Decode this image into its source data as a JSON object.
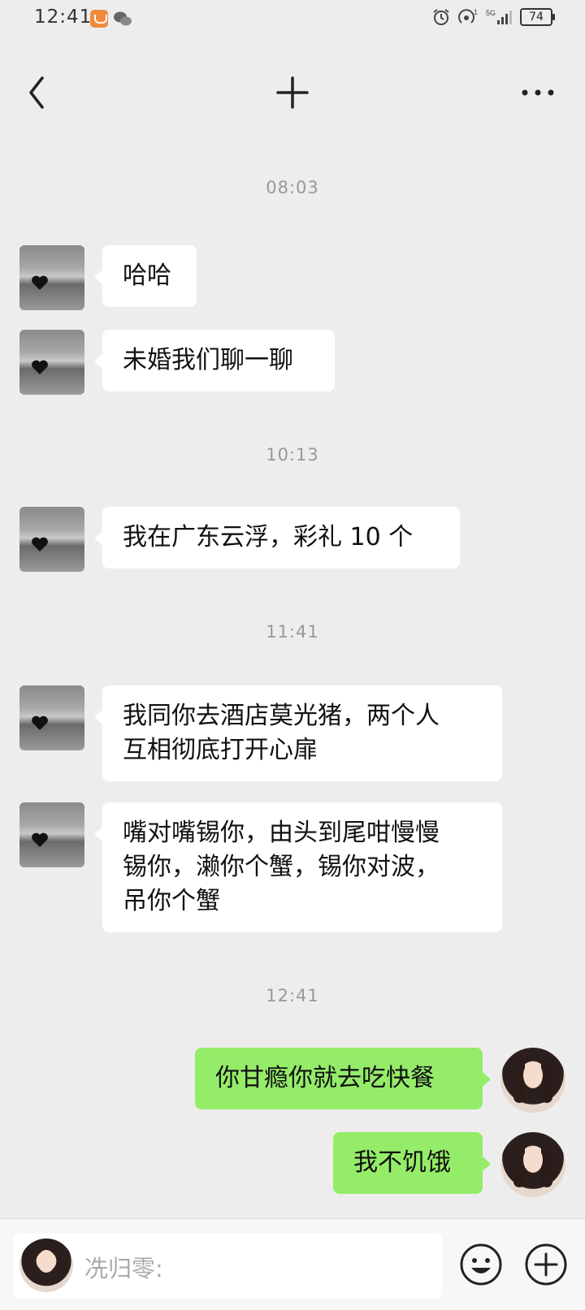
{
  "status_bar": {
    "time": "12:41",
    "battery": "74",
    "network": "5G"
  },
  "nav": {
    "back_icon": "chevron-left-icon",
    "plus_icon": "plus-icon",
    "more_icon": "more-horizontal-icon"
  },
  "timestamps": [
    "08:03",
    "10:13",
    "11:41",
    "12:41"
  ],
  "messages": [
    {
      "side": "left",
      "lines": [
        "哈哈"
      ]
    },
    {
      "side": "left",
      "lines": [
        "未婚我们聊一聊"
      ]
    },
    {
      "side": "left",
      "lines": [
        "我在广东云浮，彩礼 10 个"
      ]
    },
    {
      "side": "left",
      "lines": [
        "我同你去酒店莫光猪，两个人",
        "互相彻底打开心扉"
      ]
    },
    {
      "side": "left",
      "lines": [
        "嘴对嘴锡你，由头到尾咁慢慢",
        "锡你，濑你个蟹，锡你对波，",
        "吊你个蟹"
      ]
    },
    {
      "side": "right",
      "lines": [
        "你甘瘾你就去吃快餐"
      ]
    },
    {
      "side": "right",
      "lines": [
        "我不饥饿"
      ]
    }
  ],
  "input": {
    "placeholder": "冼归零:",
    "emoji_icon": "emoji-icon",
    "add_icon": "add-circle-icon"
  },
  "colors": {
    "background": "#ededed",
    "bubble_self": "#95ec69",
    "bubble_other": "#ffffff"
  }
}
